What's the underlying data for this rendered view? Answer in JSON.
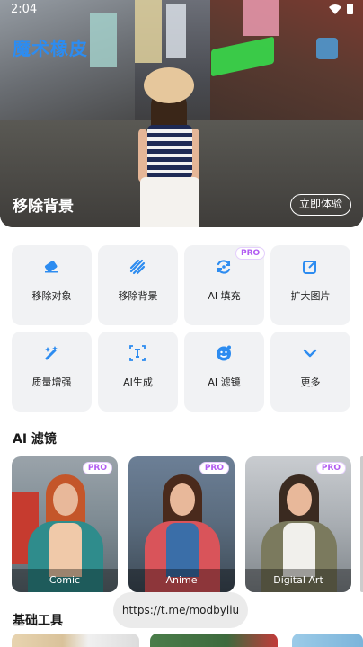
{
  "status_bar": {
    "time": "2:04"
  },
  "hero": {
    "app_title": "魔术橡皮",
    "title": "移除背景",
    "cta_label": "立即体验"
  },
  "tools": [
    {
      "label": "移除对象",
      "icon": "eraser-icon",
      "pro": ""
    },
    {
      "label": "移除背景",
      "icon": "stripes-icon",
      "pro": ""
    },
    {
      "label": "AI 填充",
      "icon": "refresh-icon",
      "pro": "PRO"
    },
    {
      "label": "扩大图片",
      "icon": "expand-image-icon",
      "pro": ""
    },
    {
      "label": "质量增强",
      "icon": "magic-wand-icon",
      "pro": ""
    },
    {
      "label": "AI生成",
      "icon": "text-cursor-icon",
      "pro": ""
    },
    {
      "label": "AI 滤镜",
      "icon": "face-filter-icon",
      "pro": ""
    },
    {
      "label": "更多",
      "icon": "chevron-down-icon",
      "pro": ""
    }
  ],
  "ai_filters": {
    "title": "AI 滤镜",
    "cards": [
      {
        "label": "Comic",
        "pro": "PRO"
      },
      {
        "label": "Anime",
        "pro": "PRO"
      },
      {
        "label": "Digital Art",
        "pro": "PRO"
      }
    ]
  },
  "basic_tools": {
    "title": "基础工具"
  },
  "toast": {
    "text": "https://t.me/modbyliu"
  },
  "colors": {
    "accent": "#2d8cf0",
    "pro": "#b25cf2",
    "tile_bg": "#f1f2f4"
  }
}
